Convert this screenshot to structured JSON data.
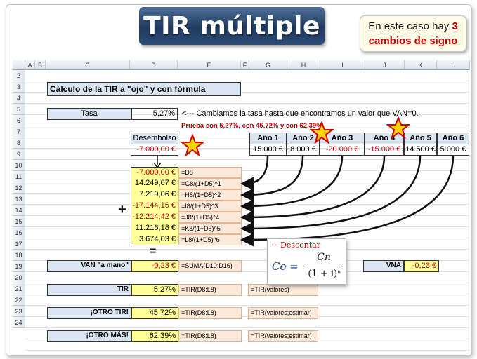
{
  "banner": {
    "title": "TIR múltiple"
  },
  "callout": {
    "line1_a": "En este caso hay ",
    "line1_b": "3",
    "line2": "cambios de signo"
  },
  "columns": [
    "A",
    "B",
    "C",
    "D",
    "E",
    "F",
    "G",
    "H",
    "I",
    "J",
    "K",
    "L"
  ],
  "rows": [
    "2",
    "3",
    "4",
    "5",
    "6",
    "7",
    "8",
    "9",
    "10",
    "11",
    "12",
    "13",
    "14",
    "15",
    "16",
    "17",
    "18",
    "19",
    "20",
    "21",
    "22",
    "23",
    "24"
  ],
  "heading": "Cálculo de la TIR a \"ojo\" y con fórmula",
  "tasa": {
    "label": "Tasa",
    "value": "5,27%",
    "note": "<--- Cambiamos la tasa hasta que encontramos un valor que VAN=0."
  },
  "prueba": "Prueba con 5,27%, con 45,72% y con 62,39%",
  "desembolso": {
    "label": "Desembolso",
    "value": "-7.000,00 €"
  },
  "years": {
    "labels": [
      "Año 1",
      "Año 2",
      "Año 3",
      "Año 4",
      "Año 5",
      "Año 6"
    ],
    "values": [
      "15.000 €",
      "8.000 €",
      "-20.000 €",
      "-15.000 €",
      "14.500 €",
      "5.000 €"
    ]
  },
  "discounted": {
    "values": [
      "-7.000,00 €",
      "14.249,07 €",
      "7.219,06 €",
      "-17.144,16 €",
      "-12.214,42 €",
      "11.216,18 €",
      "3.674,03 €"
    ],
    "formulas": [
      "=D8",
      "=G8/(1+D5)^1",
      "=H8/(1+D5)^2",
      "=I8/(1+D5)^3",
      "=J8/(1+D5)^4",
      "=K8/(1+D5)^5",
      "=L8/(1+D5)^6"
    ]
  },
  "plus": "+",
  "equals": "=",
  "van": {
    "label": "VAN \"a mano\"",
    "value": "-0,23 €",
    "formula": "=SUMA(D10:D16)"
  },
  "vna": {
    "label": "VNA",
    "value": "-0,23 €"
  },
  "discount_formula": {
    "label": "Descontar",
    "arrow": "←",
    "co": "Co =",
    "numerator": "Cn",
    "denominator": "(1 + i)ⁿ"
  },
  "tir1": {
    "label": "TIR",
    "value": "5,27%",
    "formula": "=TIR(D8:L8)",
    "syntax": "=TIR(valores)"
  },
  "tir2": {
    "label": "¡OTRO TIR!",
    "value": "45,72%",
    "formula": "=TIR(D8:L8)",
    "syntax": "=TIR(valores;estimar)"
  },
  "tir3": {
    "label": "¡OTRO MÁS!",
    "value": "62,39%",
    "formula": "=TIR(D8:L8)",
    "syntax": "=TIR(valores;estimar)"
  },
  "colors": {
    "accent_blue": "#dbe5f1",
    "highlight_yellow": "#ffff99",
    "formula_peach": "#fde9d9",
    "negative_red": "#c00000",
    "banner_navy": "#1f3a5f"
  }
}
